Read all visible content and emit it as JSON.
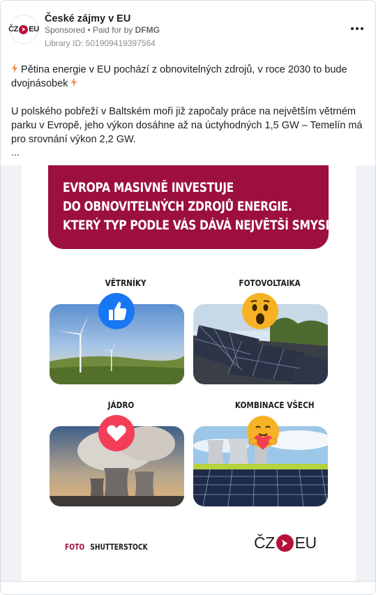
{
  "post": {
    "page_name": "České zájmy v EU",
    "sponsored": "Sponsored",
    "separator": "•",
    "paid_for_prefix": "Paid for by",
    "payer": "DFMG",
    "library_id": "Library ID: 501909419397564",
    "avatar_logo": {
      "left": "ČZ",
      "right": "EU"
    },
    "body_paragraph_1": "Pětina energie v EU pochází z obnovitelných zdrojů, v roce 2030 to bude dvojnásobek",
    "body_paragraph_2": "U polského pobřeží v Baltském moři již započaly práce na největším větrném parku v Evropě, jeho výkon dosáhne až na úctyhodných 1,5 GW – Temelín má pro srovnání výkon 2,2 GW.",
    "ellipsis": "..."
  },
  "creative": {
    "banner_lines": [
      "EVROPA MASIVNĚ INVESTUJE",
      "DO OBNOVITELNÝCH ZDROJŮ ENERGIE.",
      "KTERÝ TYP PODLE VÁS DÁVÁ NEJVĚTŠÍ SMYSL?"
    ],
    "tiles": [
      {
        "label": "VĚTRNÍKY",
        "reaction": "like-reaction-icon"
      },
      {
        "label": "FOTOVOLTAIKA",
        "reaction": "wow-reaction-icon"
      },
      {
        "label": "JÁDRO",
        "reaction": "love-reaction-icon"
      },
      {
        "label": "KOMBINACE VŠECH",
        "reaction": "care-reaction-icon"
      }
    ],
    "foto_label": "FOTO",
    "foto_source": "SHUTTERSTOCK",
    "brand": {
      "left": "ČZ",
      "right": "EU"
    }
  },
  "colors": {
    "brand_burgundy": "#9c0f3f",
    "brand_arrow": "#b5113a",
    "like_blue": "#1877f2",
    "love_red": "#f33e58",
    "emoji_yellow": "#f7b125"
  }
}
